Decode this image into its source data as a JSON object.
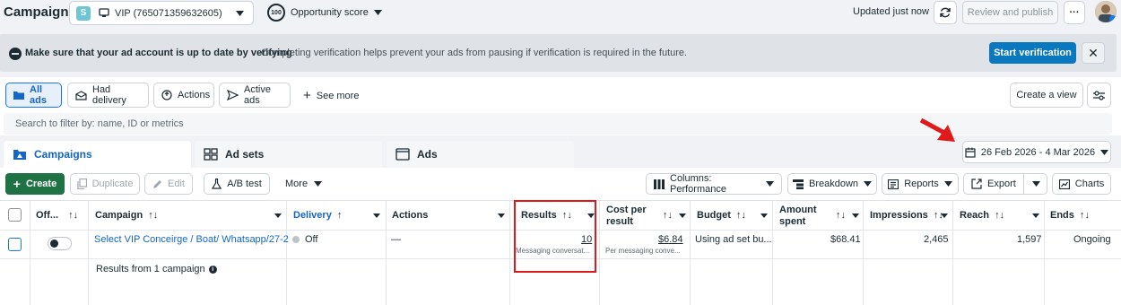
{
  "header": {
    "title": "Campaigns",
    "account_initial": "S",
    "account_name": "VIP (765071359632605)",
    "opportunity_score": "100",
    "opportunity_label": "Opportunity score",
    "updated": "Updated just now",
    "review_label": "Review and publish",
    "more_label": "···"
  },
  "banner": {
    "bold": "Make sure that your ad account is up to date by verifying",
    "text": "Completing verification helps prevent your ads from pausing if verification is required in the future.",
    "action": "Start verification",
    "close": "✕"
  },
  "filters": {
    "pills": [
      "All ads",
      "Had delivery",
      "Actions",
      "Active ads"
    ],
    "see_more": "See more",
    "create_view": "Create a view",
    "search_placeholder": "Search to filter by: name, ID or metrics"
  },
  "tabs": [
    "Campaigns",
    "Ad sets",
    "Ads"
  ],
  "date_range": "26 Feb 2026 - 4 Mar 2026",
  "toolbar": {
    "create": "Create",
    "duplicate": "Duplicate",
    "edit": "Edit",
    "ab_test": "A/B test",
    "more": "More",
    "columns": "Columns: Performance",
    "breakdown": "Breakdown",
    "reports": "Reports",
    "export": "Export",
    "charts": "Charts"
  },
  "table": {
    "headers": {
      "offon": "Off...",
      "campaign": "Campaign",
      "delivery": "Delivery",
      "actions": "Actions",
      "results": "Results",
      "cost1": "Cost per",
      "cost2": "result",
      "budget": "Budget",
      "amount1": "Amount",
      "amount2": "spent",
      "impressions": "Impressions",
      "reach": "Reach",
      "ends": "Ends"
    },
    "row": {
      "campaign": "Select VIP Conceirge / Boat/ Whatsapp/27-2",
      "delivery": "Off",
      "actions": "—",
      "results": "10",
      "results_sub": "Messaging conversat...",
      "cost": "$6.84",
      "cost_sub": "Per messaging conve...",
      "budget": "Using ad set bu...",
      "amount": "$68.41",
      "impressions": "2,465",
      "reach": "1,597",
      "ends": "Ongoing"
    },
    "summary": "Results from 1 campaign"
  },
  "colors": {
    "primary": "#0a78be",
    "create_green": "#1f7244",
    "highlight_red": "#e01a1a",
    "link_blue": "#1466c8"
  }
}
